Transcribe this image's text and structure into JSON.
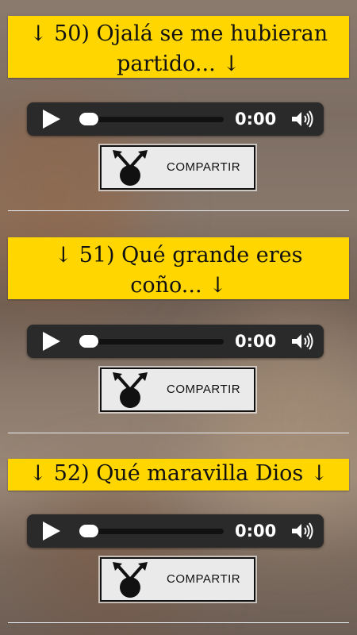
{
  "entries": [
    {
      "title": "↓ 50) Ojalá se me hubieran partido... ↓",
      "time": "0:00",
      "share_label": "COMPARTIR"
    },
    {
      "title": "↓ 51) Qué grande eres coño... ↓",
      "time": "0:00",
      "share_label": "COMPARTIR"
    },
    {
      "title": "↓ 52) Qué maravilla Dios ↓",
      "time": "0:00",
      "share_label": "COMPARTIR"
    }
  ],
  "icons": {
    "play": "play-icon",
    "volume": "volume-icon",
    "share": "share-icon"
  },
  "colors": {
    "title_background": "#ffd600",
    "player_background": "#2a2a2a"
  }
}
